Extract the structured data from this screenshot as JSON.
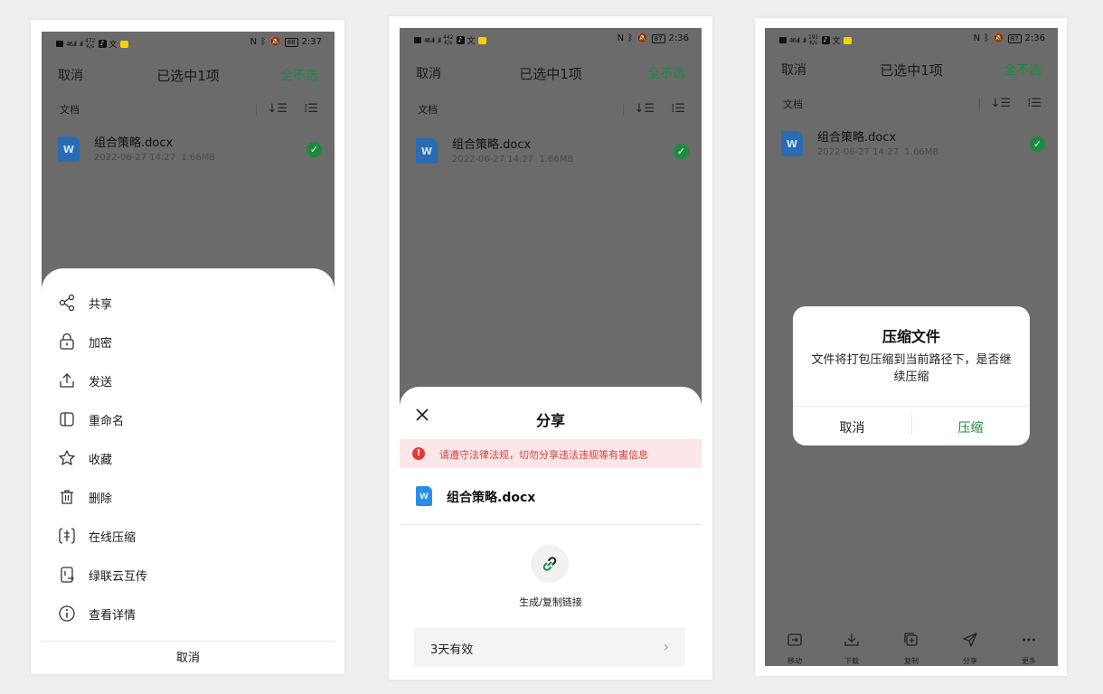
{
  "status_bar": {
    "p1": {
      "left_network": "46",
      "net_speed_top": "472",
      "net_speed_bottom": "K/s",
      "battery": "88",
      "time": "2:37"
    },
    "p2": {
      "left_network": "46",
      "net_speed_top": "442",
      "net_speed_bottom": "K/s",
      "battery": "87",
      "time": "2:36"
    },
    "p3": {
      "left_network": "46",
      "net_speed_top": "191",
      "net_speed_bottom": "K/s",
      "battery": "87",
      "time": "2:36"
    }
  },
  "top_bar": {
    "cancel": "取消",
    "title": "已选中1项",
    "select_all": "全不选"
  },
  "sub_bar": {
    "label": "文档",
    "sort_icon": "sort-icon",
    "view_icon": "view-toggle-icon"
  },
  "file": {
    "name": "组合策略.docx",
    "date": "2022-06-27 14:27",
    "size": "1.66MB"
  },
  "menu": {
    "items": [
      {
        "label": "共享",
        "icon": "share-nodes-icon"
      },
      {
        "label": "加密",
        "icon": "lock-icon"
      },
      {
        "label": "发送",
        "icon": "upload-icon"
      },
      {
        "label": "重命名",
        "icon": "rename-icon"
      },
      {
        "label": "收藏",
        "icon": "star-icon"
      },
      {
        "label": "删除",
        "icon": "trash-icon"
      },
      {
        "label": "在线压缩",
        "icon": "compress-icon"
      },
      {
        "label": "绿联云互传",
        "icon": "cloud-transfer-icon"
      },
      {
        "label": "查看详情",
        "icon": "info-icon"
      }
    ],
    "cancel": "取消"
  },
  "share_sheet": {
    "title": "分享",
    "warning": "请遵守法律法规，切勿分享违法违规等有害信息",
    "file_name": "组合策略.docx",
    "link_label": "生成/复制链接",
    "validity": "3天有效"
  },
  "compress_dialog": {
    "title": "压缩文件",
    "message": "文件将打包压缩到当前路径下，是否继续压缩",
    "cancel": "取消",
    "confirm": "压缩"
  },
  "bottom_bar": {
    "items": [
      {
        "label": "移动",
        "icon": "move-icon"
      },
      {
        "label": "下载",
        "icon": "download-icon"
      },
      {
        "label": "复制",
        "icon": "copy-icon"
      },
      {
        "label": "分享",
        "icon": "send-icon"
      },
      {
        "label": "更多",
        "icon": "more-icon"
      }
    ]
  },
  "colors": {
    "accent_green": "#1b8a43",
    "warning_red": "#e53935",
    "doc_blue": "#2b6bb3",
    "overlay_gray": "#6b6b6b"
  }
}
